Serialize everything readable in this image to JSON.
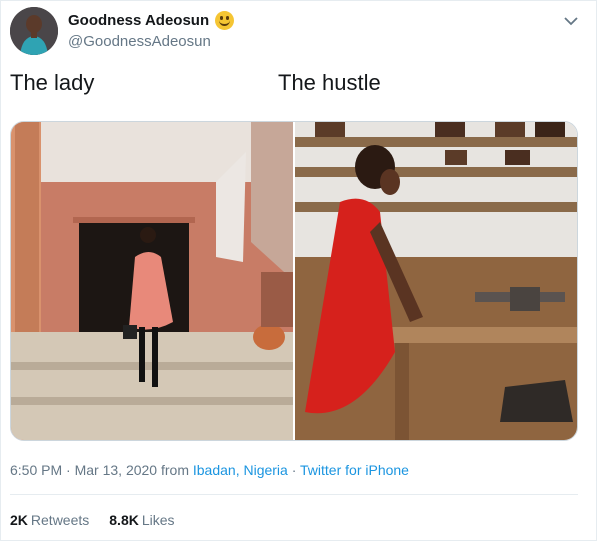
{
  "author": {
    "display_name": "Goodness Adeosun",
    "handle": "@GoodnessAdeosun",
    "emoji_icon": "smiling-face-icon"
  },
  "tweet": {
    "text_left": "The lady",
    "text_right": "The hustle"
  },
  "media": {
    "photos": [
      "photo-the-lady",
      "photo-the-hustle"
    ]
  },
  "meta": {
    "time": "6:50 PM",
    "date": "Mar 13, 2020",
    "from_word": "from",
    "location": "Ibadan, Nigeria",
    "source": "Twitter for iPhone",
    "sep": "·"
  },
  "stats": {
    "retweets_count": "2K",
    "retweets_label": "Retweets",
    "likes_count": "8.8K",
    "likes_label": "Likes"
  },
  "colors": {
    "link": "#1b95e0",
    "muted": "#657786",
    "text": "#14171a"
  }
}
